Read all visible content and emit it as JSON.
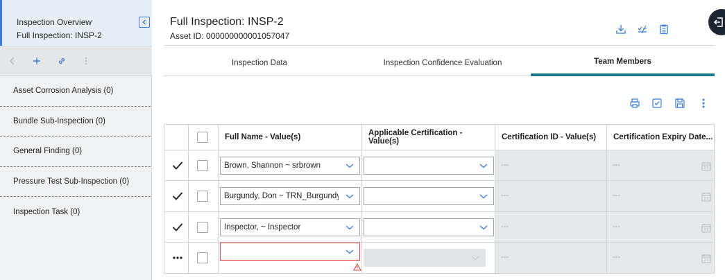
{
  "sidebar": {
    "title": "Inspection Overview",
    "subtitle": "Full Inspection: INSP-2",
    "items": [
      {
        "label": "Asset Corrosion Analysis (0)"
      },
      {
        "label": "Bundle Sub-Inspection (0)"
      },
      {
        "label": "General Finding (0)"
      },
      {
        "label": "Pressure Test Sub-Inspection (0)"
      },
      {
        "label": "Inspection Task (0)"
      }
    ],
    "toolbar_icons": [
      "back-icon",
      "add-icon",
      "link-icon",
      "more-vertical-icon"
    ]
  },
  "header": {
    "title": "Full Inspection: INSP-2",
    "asset_id": "Asset ID: 000000000001057047",
    "icons": [
      "download-icon",
      "checklist-icon",
      "clipboard-icon"
    ]
  },
  "tabs": [
    {
      "label": "Inspection Data",
      "active": false
    },
    {
      "label": "Inspection Confidence Evaluation",
      "active": false
    },
    {
      "label": "Team Members",
      "active": true
    }
  ],
  "grid": {
    "toolbar_icons": [
      "print-icon",
      "checkbox-icon",
      "save-icon",
      "more-vertical-icon"
    ],
    "columns": [
      "Full Name - Value(s)",
      "Applicable Certification - Value(s)",
      "Certification ID - Value(s)",
      "Certification Expiry Date..."
    ],
    "rows": [
      {
        "status": "check",
        "full_name": "Brown, Shannon ~ srbrown",
        "certification": "",
        "cert_id": "---",
        "expiry": "---"
      },
      {
        "status": "check",
        "full_name": "Burgundy, Don ~ TRN_Burgundy_D",
        "certification": "",
        "cert_id": "---",
        "expiry": "---"
      },
      {
        "status": "check",
        "full_name": "Inspector,  ~ Inspector",
        "certification": "",
        "cert_id": "---",
        "expiry": "---"
      },
      {
        "status": "more",
        "full_name": "",
        "certification": "",
        "cert_id": "---",
        "expiry": "---"
      }
    ]
  },
  "colors": {
    "accent": "#1b7a92",
    "sidebar_accent": "#3a7bd5",
    "error": "#e04545"
  }
}
